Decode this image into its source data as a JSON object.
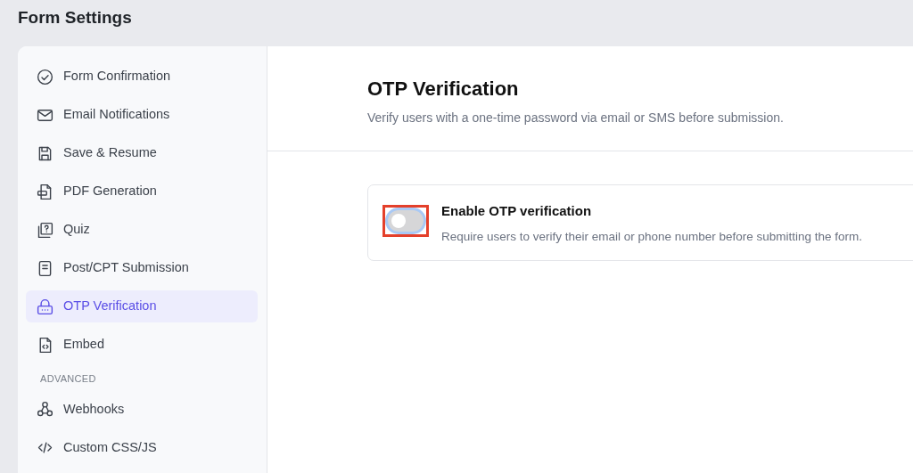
{
  "page": {
    "title": "Form Settings"
  },
  "sidebar": {
    "groups": [
      {
        "items": [
          {
            "label": "Form Confirmation",
            "selected": false
          },
          {
            "label": "Email Notifications",
            "selected": false
          },
          {
            "label": "Save & Resume",
            "selected": false
          },
          {
            "label": "PDF Generation",
            "selected": false
          },
          {
            "label": "Quiz",
            "selected": false
          },
          {
            "label": "Post/CPT Submission",
            "selected": false
          },
          {
            "label": "OTP Verification",
            "selected": true
          },
          {
            "label": "Embed",
            "selected": false
          }
        ]
      },
      {
        "heading": "ADVANCED",
        "items": [
          {
            "label": "Webhooks",
            "selected": false
          },
          {
            "label": "Custom CSS/JS",
            "selected": false
          }
        ]
      }
    ]
  },
  "main": {
    "title": "OTP Verification",
    "subtitle": "Verify users with a one-time password via email or SMS before submission.",
    "setting": {
      "label": "Enable OTP verification",
      "description": "Require users to verify their email or phone number before submitting the form.",
      "on": false,
      "highlighted": true
    }
  }
}
